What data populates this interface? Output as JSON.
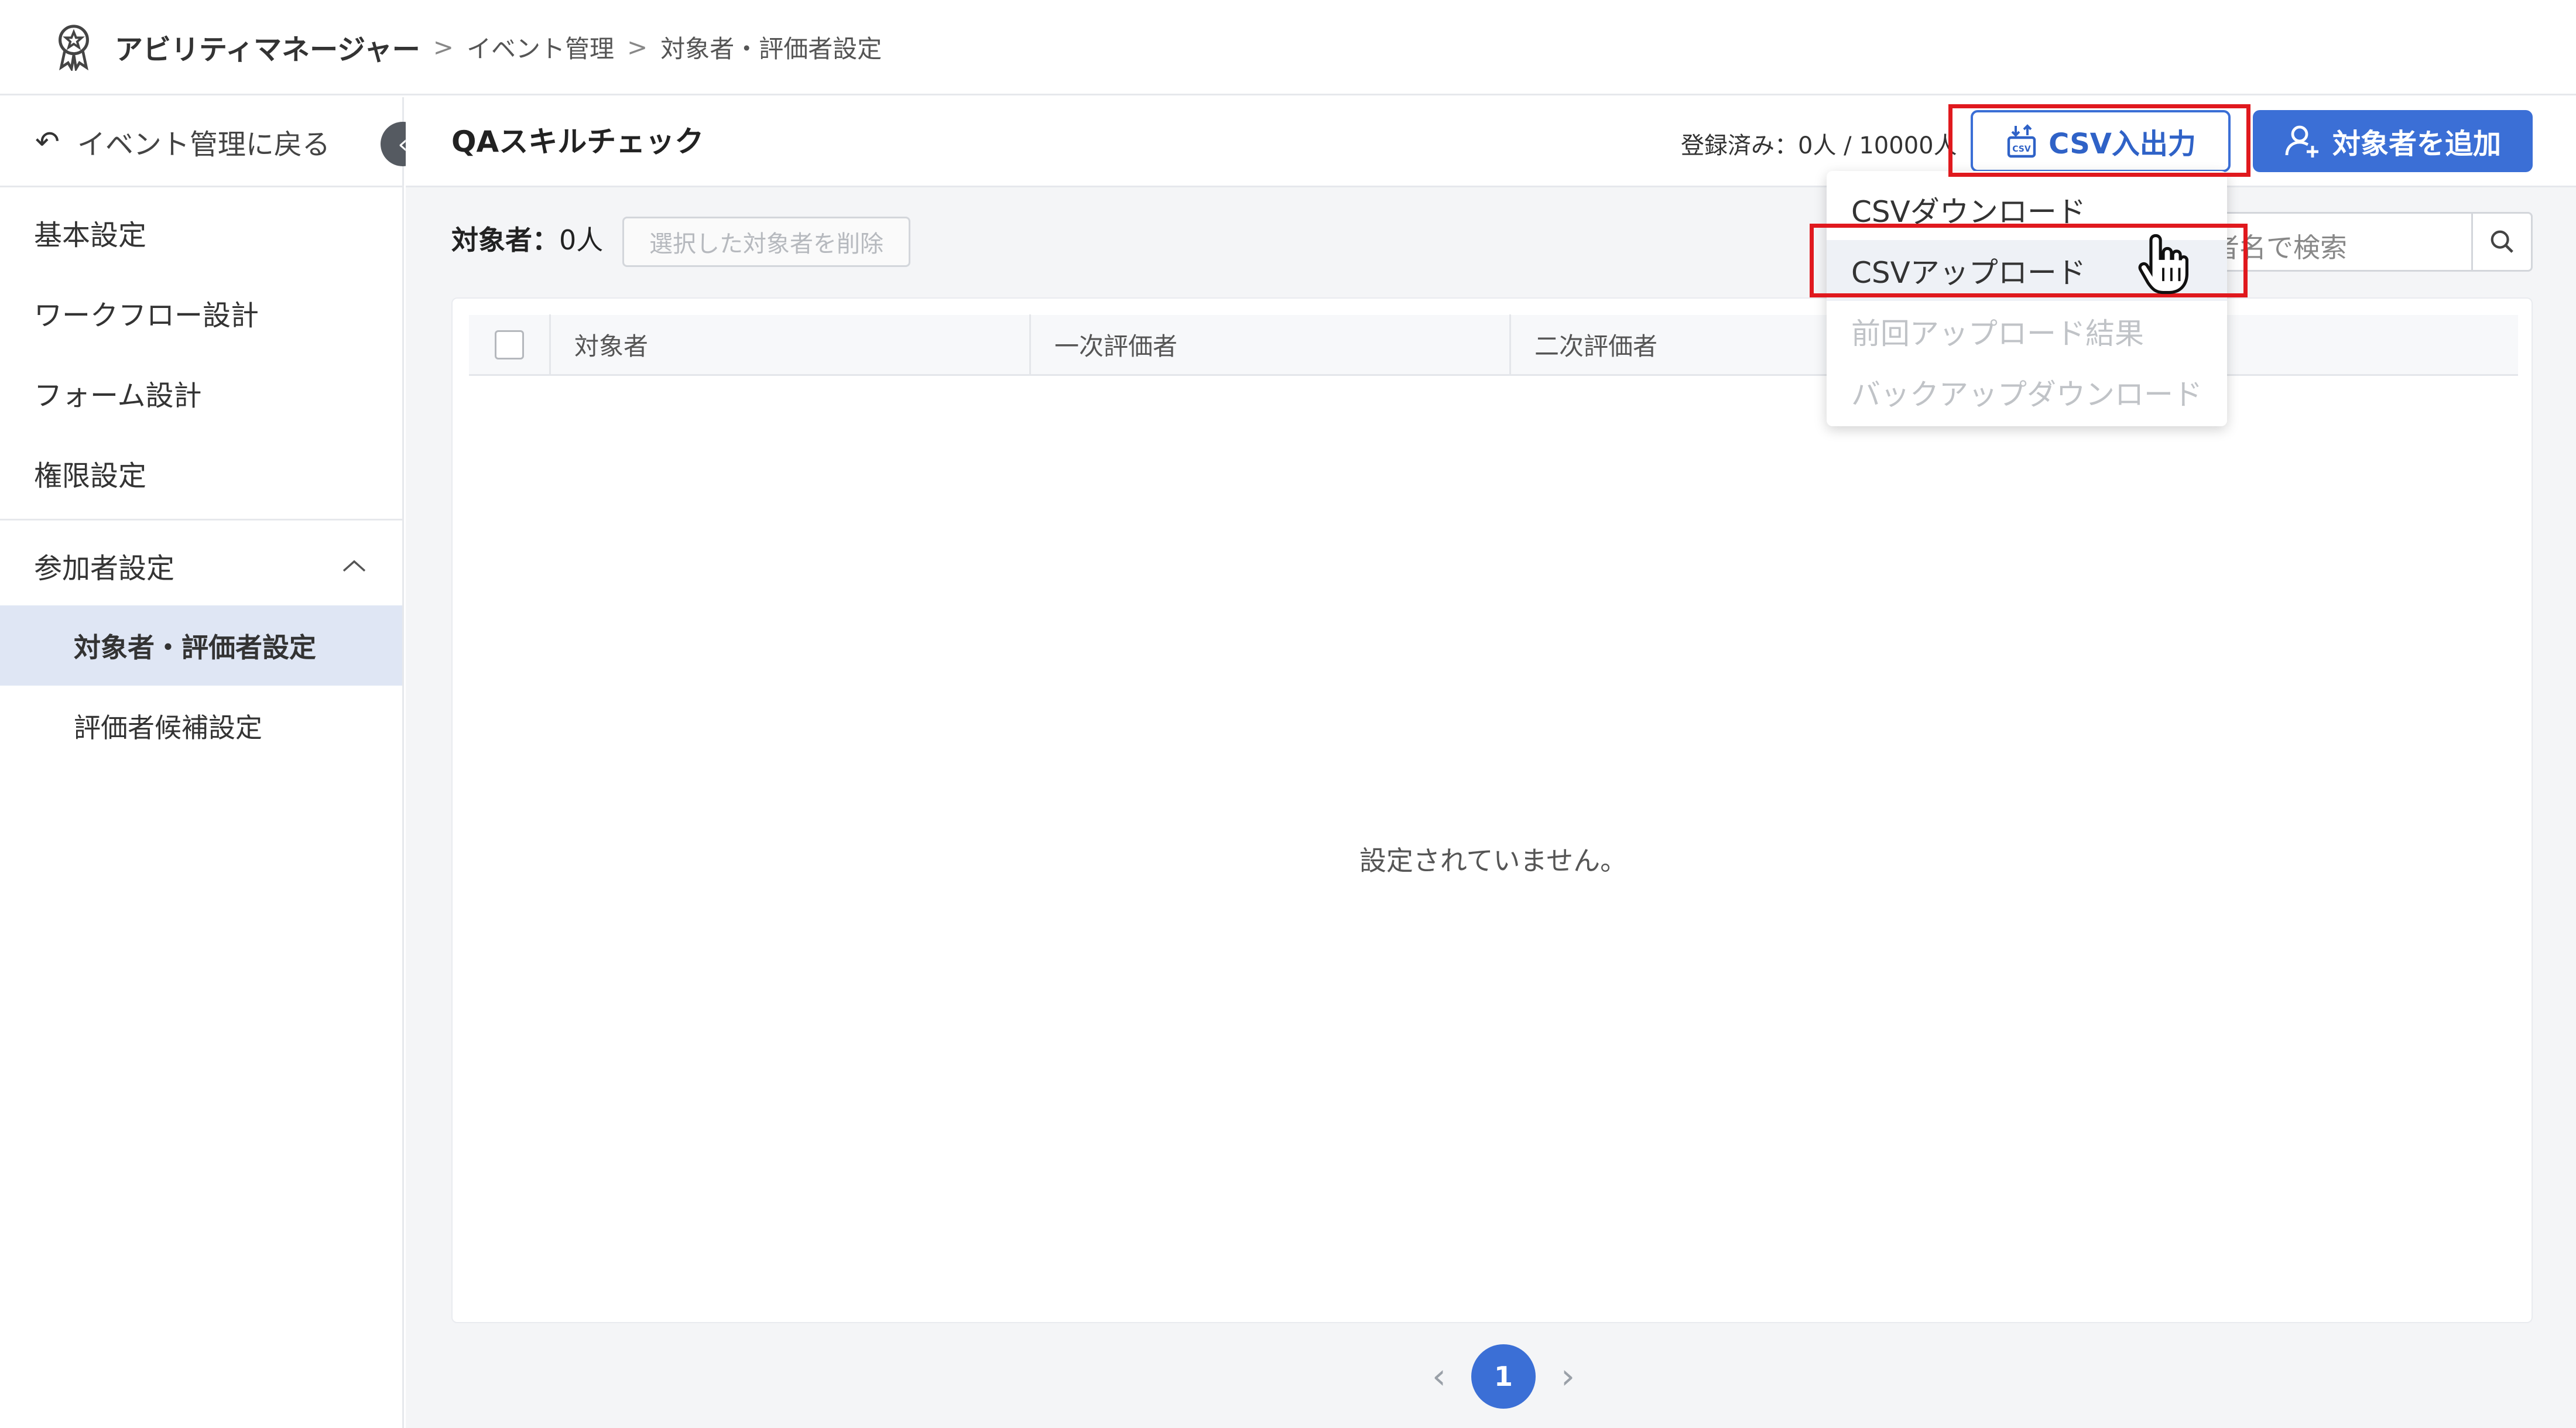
{
  "header": {
    "app_title": "アビリティマネージャー",
    "breadcrumbs": [
      "イベント管理",
      "対象者・評価者設定"
    ],
    "crumb_separator": ">"
  },
  "sidebar": {
    "back_label": "イベント管理に戻る",
    "items": [
      {
        "label": "基本設定"
      },
      {
        "label": "ワークフロー設計"
      },
      {
        "label": "フォーム設計"
      },
      {
        "label": "権限設定"
      }
    ],
    "group": {
      "label": "参加者設定",
      "expanded": true,
      "children": [
        {
          "label": "対象者・評価者設定",
          "active": true
        },
        {
          "label": "評価者候補設定",
          "active": false
        }
      ]
    }
  },
  "main": {
    "event_name": "QAスキルチェック",
    "registered_text": "登録済み：0人 / 10000人",
    "csv_button_label": "CSV入出力",
    "add_button_label": "対象者を追加",
    "target_label": "対象者：",
    "target_count": "0人",
    "delete_button_label": "選択した対象者を削除",
    "search_placeholder_visible": "者名で検索",
    "table": {
      "columns": [
        "対象者",
        "一次評価者",
        "二次評価者"
      ],
      "rows": [],
      "empty_text": "設定されていません。"
    },
    "pagination": {
      "current_page": "1",
      "prev": "‹",
      "next": "›"
    }
  },
  "dropdown": {
    "items": [
      {
        "label": "CSVダウンロード",
        "disabled": false
      },
      {
        "label": "CSVアップロード",
        "disabled": false,
        "hovered": true
      },
      {
        "label": "前回アップロード結果",
        "disabled": true
      },
      {
        "label": "バックアップダウンロード",
        "disabled": true
      }
    ]
  },
  "colors": {
    "accent": "#3b6fd6",
    "highlight": "#e0191e",
    "active_nav_bg": "#dfe6f4"
  }
}
